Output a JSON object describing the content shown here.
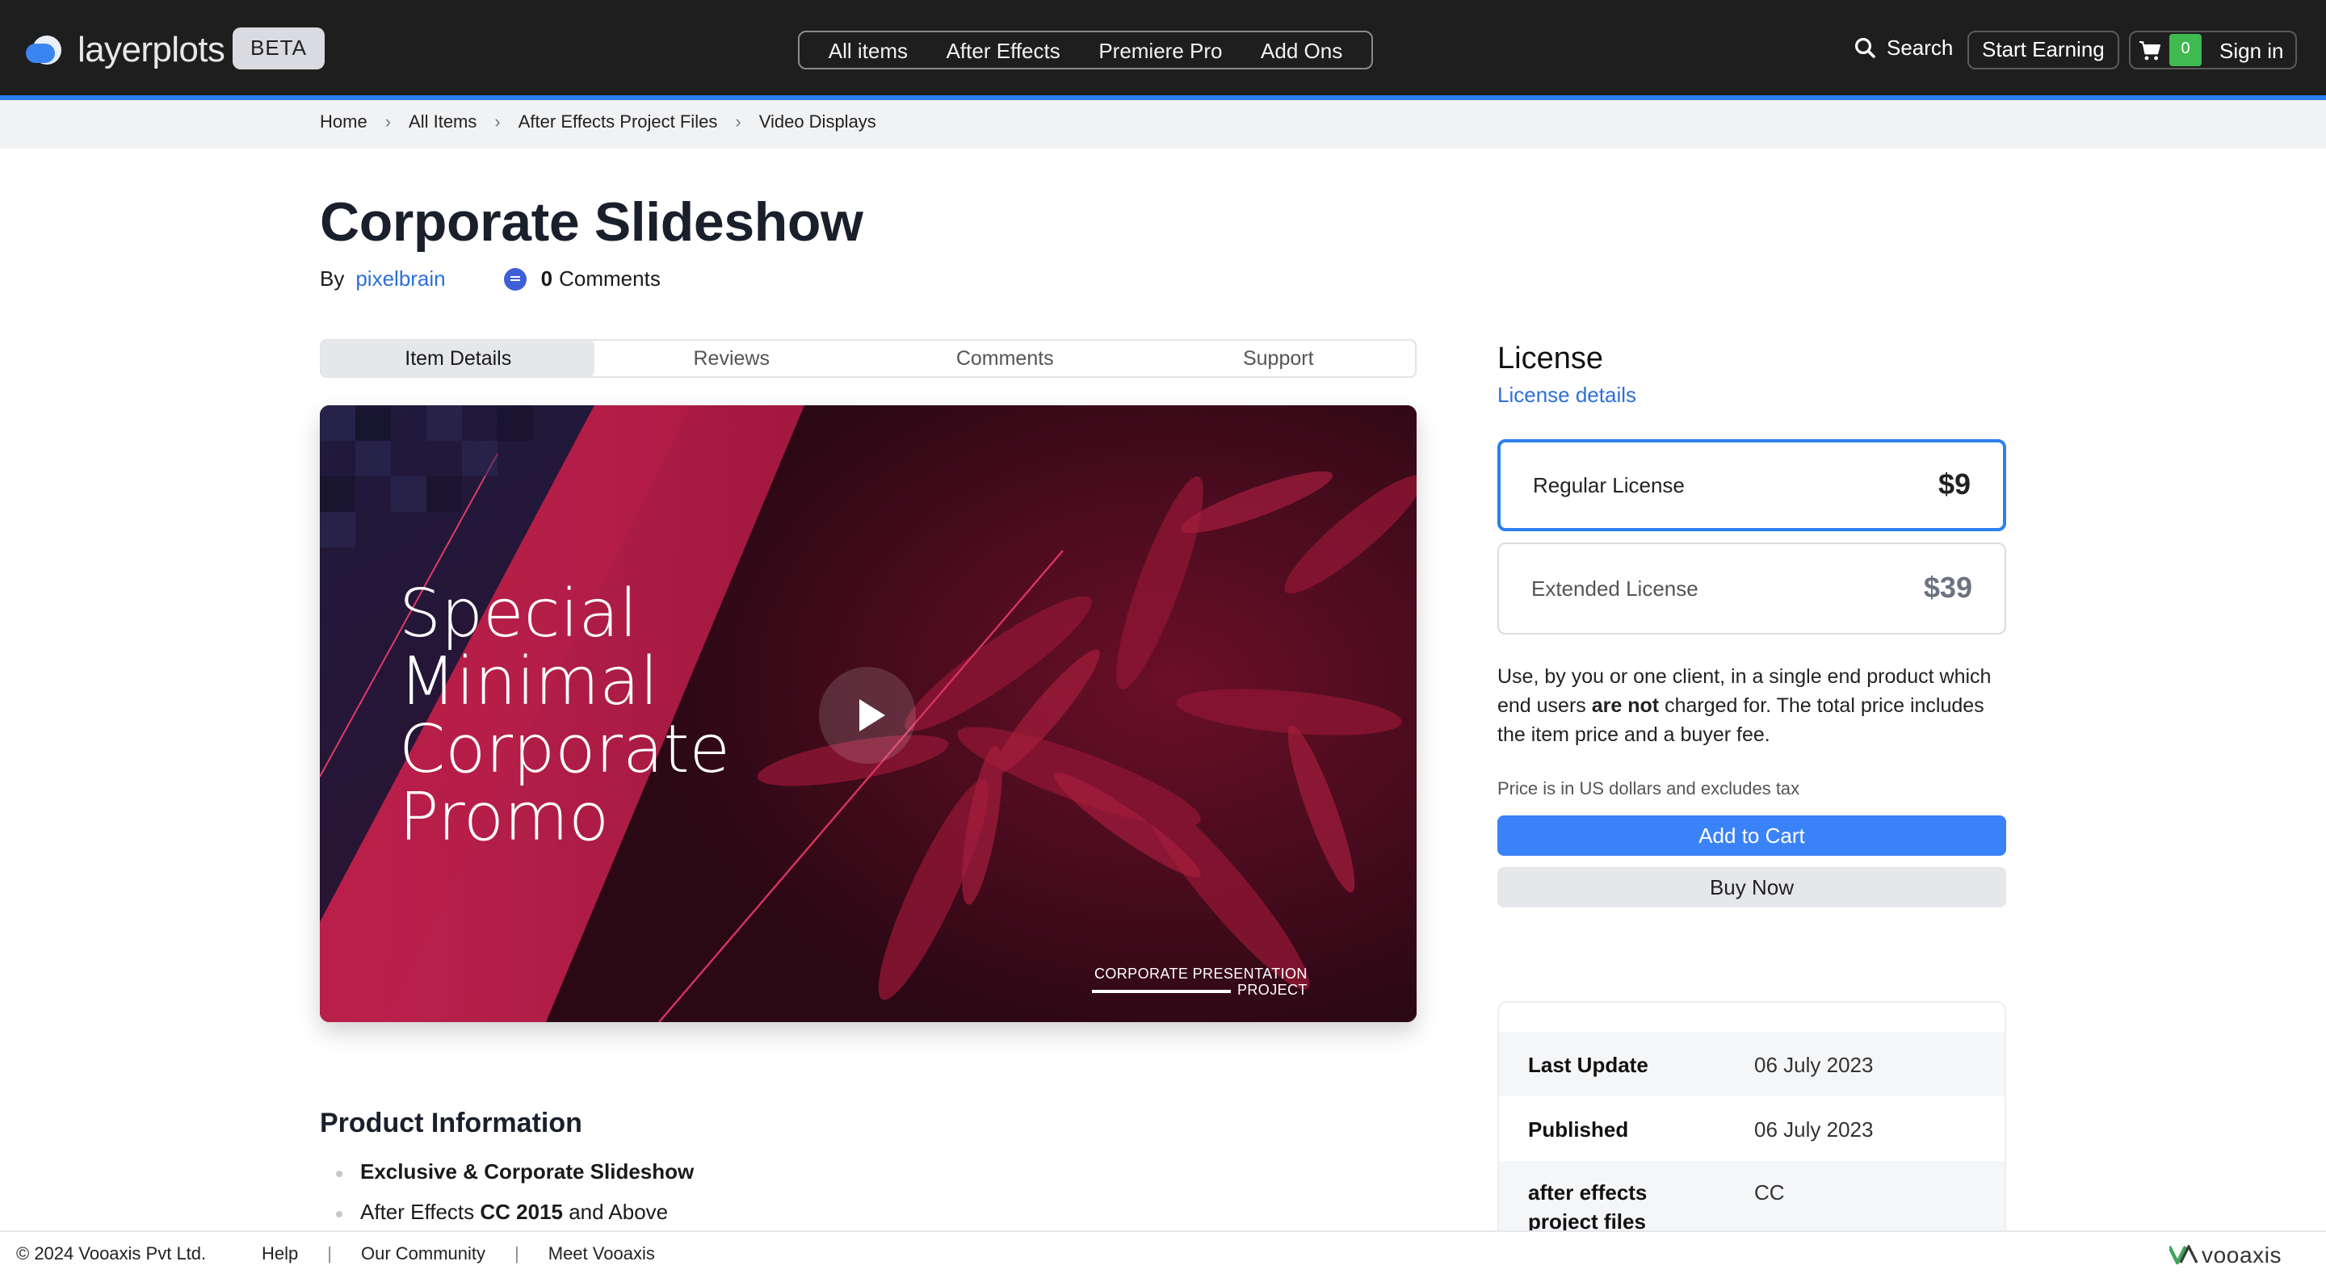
{
  "header": {
    "logo_text": "layerplots",
    "badge": "BETA",
    "nav": [
      "All items",
      "After Effects",
      "Premiere Pro",
      "Add Ons"
    ],
    "search_label": "Search",
    "earn_label": "Start Earning",
    "cart_count": "0",
    "signin_label": "Sign in",
    "accent_color": "#2d7ff0"
  },
  "breadcrumb": [
    "Home",
    "All Items",
    "After Effects Project Files",
    "Video Displays"
  ],
  "item": {
    "title": "Corporate Slideshow",
    "by_label": "By",
    "author": "pixelbrain",
    "comment_count": "0",
    "comment_label": "Comments"
  },
  "tabs": [
    "Item Details",
    "Reviews",
    "Comments",
    "Support"
  ],
  "preview": {
    "lines": [
      "Special",
      "Minimal",
      "Corporate",
      "Promo"
    ],
    "corner_label_1": "CORPORATE PRESENTATION",
    "corner_label_2": "PROJECT"
  },
  "product_info": {
    "heading": "Product Information",
    "item1_bold": "Exclusive & Corporate Slideshow",
    "item2_pre": "After Effects ",
    "item2_bold": "CC 2015",
    "item2_post": " and Above"
  },
  "license": {
    "heading": "License",
    "details_link": "License details",
    "regular_name": "Regular License",
    "regular_price": "$9",
    "extended_name": "Extended License",
    "extended_price": "$39",
    "desc_pre": "Use, by you or one client, in a single end product which end users ",
    "desc_bold": "are not",
    "desc_post": " charged for. The total price includes the item price and a buyer fee.",
    "note": "Price is in US dollars and excludes tax",
    "add_to_cart": "Add to Cart",
    "buy_now": "Buy Now"
  },
  "details": {
    "last_update_label": "Last Update",
    "last_update_value": "06 July 2023",
    "published_label": "Published",
    "published_value": "06 July 2023",
    "ae_label_1": "after effects",
    "ae_label_2": "project files",
    "ae_value": "CC"
  },
  "footer": {
    "copyright": "© 2024 Vooaxis Pvt Ltd.",
    "links": [
      "Help",
      "Our Community",
      "Meet Vooaxis"
    ],
    "brand": "vooaxis"
  }
}
